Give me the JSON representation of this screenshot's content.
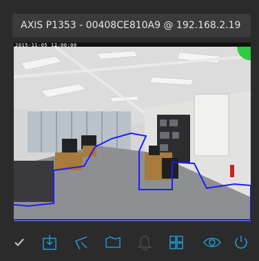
{
  "header": {
    "camera_title": "AXIS P1353 - 00408CE810A9 @ 192.168.2.19"
  },
  "video": {
    "overlay_text": "2015-11-05 12:00:00",
    "detection_zone_color": "#1a1aff",
    "status_indicator_color": "#2ecc40"
  },
  "toolbar": {
    "accent_color": "#1e9ad6",
    "buttons": [
      {
        "icon": "checkbox-checked-icon"
      },
      {
        "icon": "download-snapshot-icon"
      },
      {
        "icon": "line-tool-icon"
      },
      {
        "icon": "area-tool-icon"
      },
      {
        "icon": "bell-icon"
      },
      {
        "icon": "grid-view-icon"
      },
      {
        "icon": "eye-icon"
      },
      {
        "icon": "power-icon"
      }
    ]
  }
}
